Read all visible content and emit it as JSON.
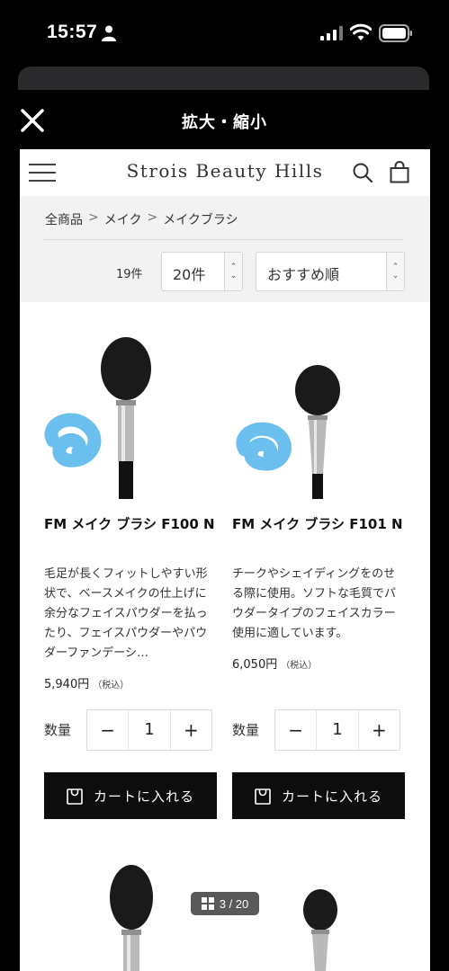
{
  "status_bar": {
    "time": "15:57"
  },
  "viewer": {
    "title": "拡大・縮小"
  },
  "site": {
    "logo": "Strois Beauty Hills"
  },
  "breadcrumb": {
    "items": [
      "全商品",
      "メイク",
      "メイクブラシ"
    ],
    "separator": ">"
  },
  "listing": {
    "count": "19件",
    "per_page": "20件",
    "sort": "おすすめ順",
    "select_arrows": "⌃⌄"
  },
  "products": [
    {
      "name": "FM メイク ブラシ F100 N",
      "description": "毛足が長くフィットしやすい形状で、ベースメイクの仕上げに余分なフェイスパウダーを払ったり、フェイスパウダーやパウダーファンデーシ…",
      "price": "5,940円",
      "tax": "（税込）",
      "qty_label": "数量",
      "qty": "1",
      "minus": "−",
      "plus": "+",
      "cart_label": "カートに入れる"
    },
    {
      "name": "FM メイク ブラシ F101 N",
      "description": "チークやシェイディングをのせる際に使用。ソフトな毛質でパウダータイプのフェイスカラー使用に適しています。",
      "price": "6,050円",
      "tax": "（税込）",
      "qty_label": "数量",
      "qty": "1",
      "minus": "−",
      "plus": "+",
      "cart_label": "カートに入れる"
    }
  ],
  "page_indicator": {
    "text": "3 / 20"
  },
  "colors": {
    "scribble": "#5bb8ec",
    "button": "#0d0d0d",
    "filter_bg": "#f2f2f2"
  }
}
